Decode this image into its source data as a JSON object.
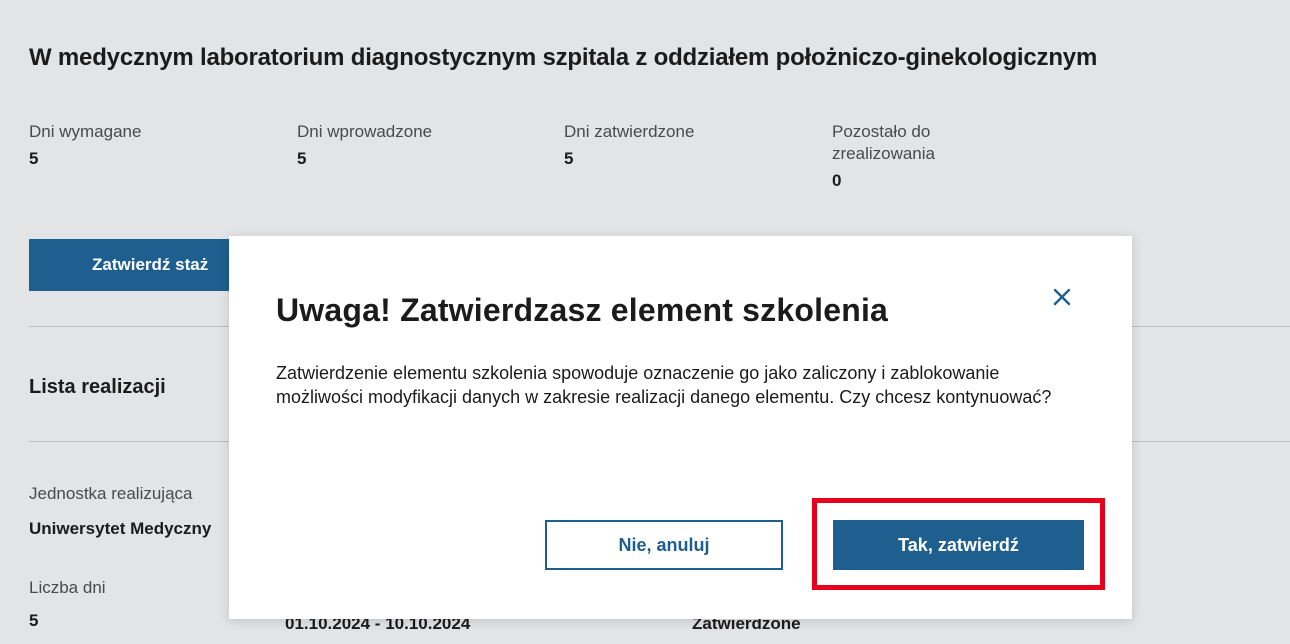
{
  "page": {
    "title": "W medycznym laboratorium diagnostycznym szpitala z oddziałem położniczo-ginekologicznym",
    "stats": [
      {
        "label": "Dni wymagane",
        "value": "5"
      },
      {
        "label": "Dni wprowadzone",
        "value": "5"
      },
      {
        "label": "Dni zatwierdzone",
        "value": "5"
      },
      {
        "label": "Pozostało do zrealizowania",
        "value": "0"
      }
    ],
    "confirm_stage_button": "Zatwierdź staż",
    "list_title": "Lista realizacji",
    "unit_label": "Jednostka realizująca",
    "unit_value": "Uniwersytet Medyczny",
    "days_label": "Liczba dni",
    "days_value": "5",
    "date_range": "01.10.2024 - 10.10.2024",
    "status_value": "Zatwierdzone"
  },
  "modal": {
    "title": "Uwaga! Zatwierdzasz element szkolenia",
    "body": "Zatwierdzenie elementu szkolenia spowoduje oznaczenie go jako zaliczony i zablokowanie możliwości modyfikacji danych w zakresie realizacji danego elementu. Czy chcesz kontynuować?",
    "close_icon": "close-icon",
    "cancel_label": "Nie, anuluj",
    "confirm_label": "Tak, zatwierdź"
  },
  "colors": {
    "primary": "#1f5f8f",
    "backdrop": "#e3e4e6",
    "highlight": "#e5001b"
  }
}
